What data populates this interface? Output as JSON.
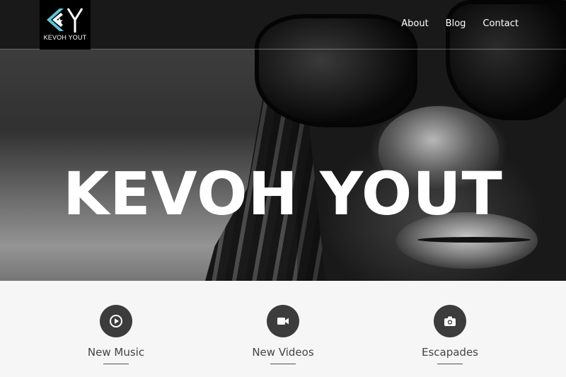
{
  "brand": {
    "logo_text": "KEVOH YOUT",
    "accent_color": "#5ec7d8"
  },
  "nav": {
    "items": [
      {
        "label": "About"
      },
      {
        "label": "Blog"
      },
      {
        "label": "Contact"
      }
    ]
  },
  "hero": {
    "title": "KEVOH YOUT"
  },
  "features": [
    {
      "label": "New Music",
      "icon": "play-icon"
    },
    {
      "label": "New Videos",
      "icon": "video-camera-icon"
    },
    {
      "label": "Escapades",
      "icon": "camera-icon"
    }
  ]
}
